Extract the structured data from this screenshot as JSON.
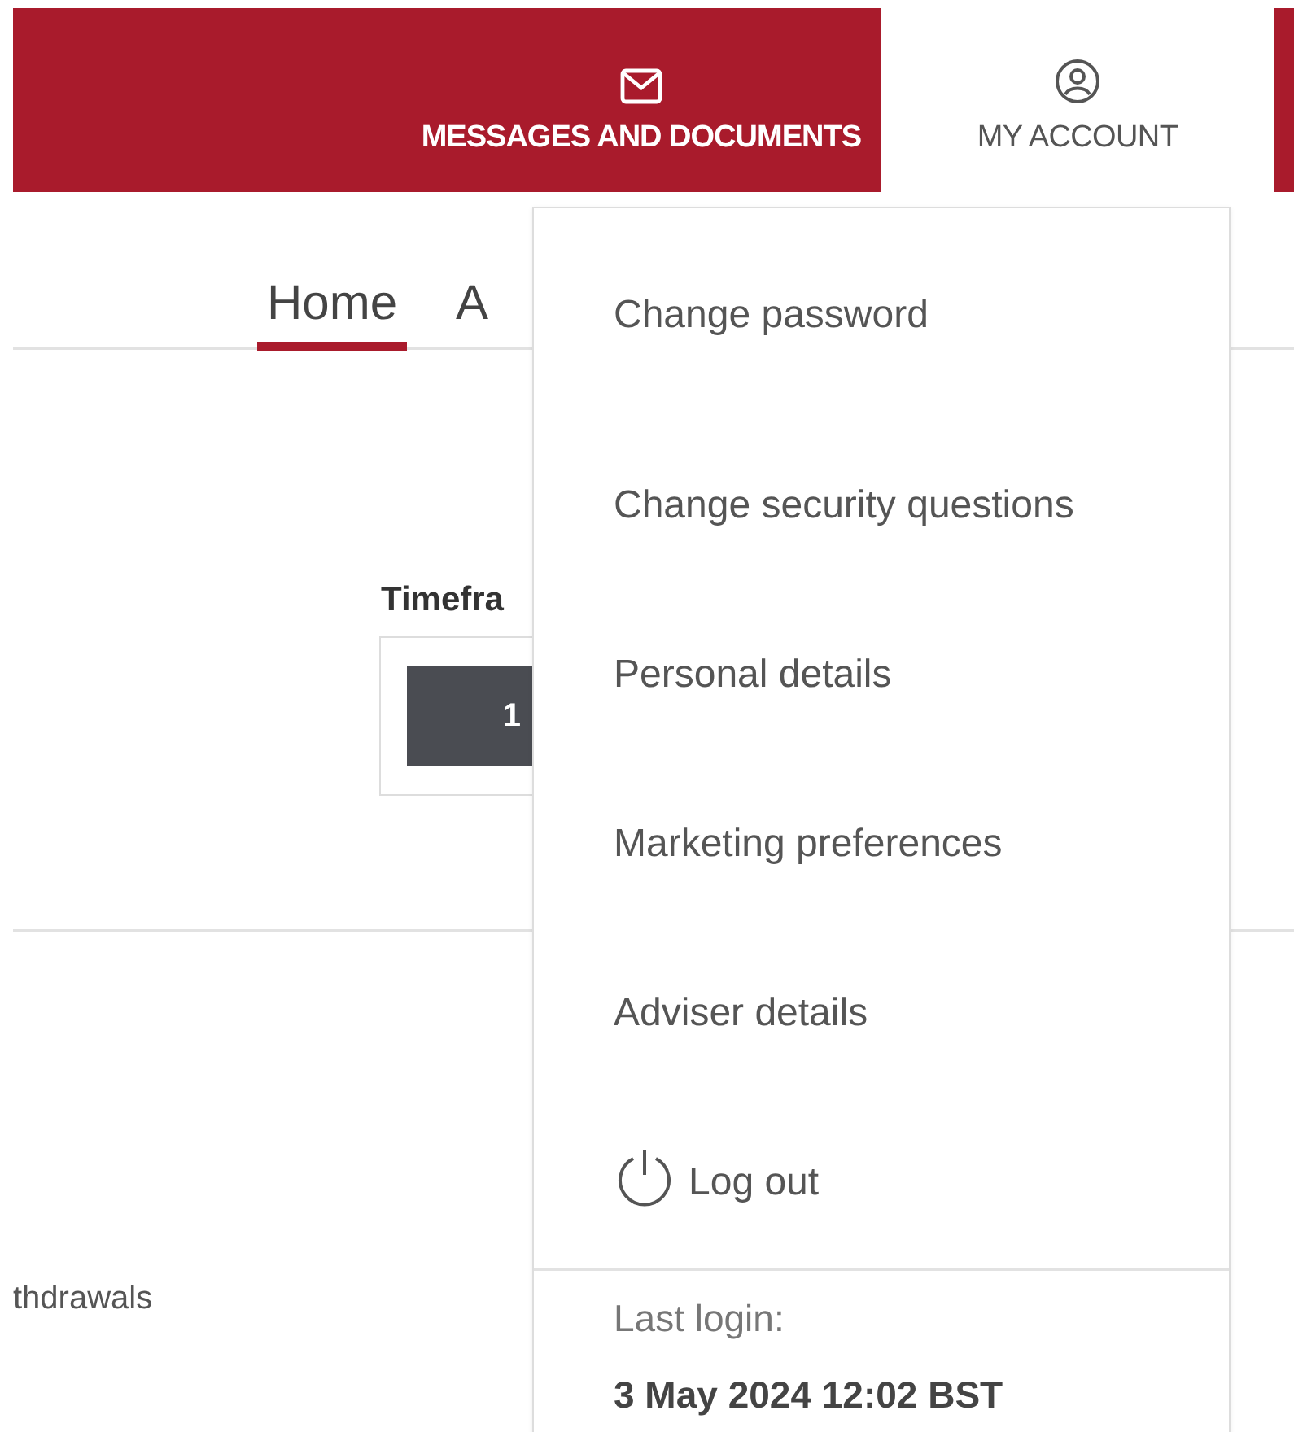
{
  "header": {
    "tabs": [
      {
        "label": "MESSAGES AND DOCUMENTS",
        "kind": "mail",
        "selected": false
      },
      {
        "label": "MY ACCOUNT",
        "kind": "user",
        "selected": true
      }
    ]
  },
  "nav": {
    "tabs": [
      {
        "label": "Home",
        "selected": true
      },
      {
        "label": "A",
        "selected": false
      }
    ]
  },
  "timeframe": {
    "label": "Timefra",
    "button": "1"
  },
  "footer_text": "thdrawals",
  "account_menu": {
    "items": [
      {
        "label": "Change password",
        "kind": "plain"
      },
      {
        "label": "Change security questions",
        "kind": "plain"
      },
      {
        "label": "Personal details",
        "kind": "plain"
      },
      {
        "label": "Marketing preferences",
        "kind": "plain"
      },
      {
        "label": "Adviser details",
        "kind": "plain"
      },
      {
        "label": "Log out",
        "kind": "logout"
      }
    ],
    "last_login_label": "Last login:",
    "last_login": "3 May 2024 12:02 BST"
  }
}
